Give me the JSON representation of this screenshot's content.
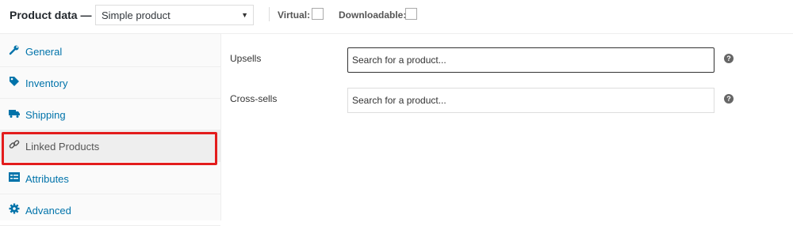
{
  "header": {
    "title": "Product data —",
    "product_type": "Simple product",
    "virtual_label": "Virtual:",
    "downloadable_label": "Downloadable:",
    "virtual_checked": false,
    "downloadable_checked": false
  },
  "sidebar": {
    "items": [
      {
        "label": "General",
        "icon": "wrench-icon"
      },
      {
        "label": "Inventory",
        "icon": "tag-icon"
      },
      {
        "label": "Shipping",
        "icon": "truck-icon"
      },
      {
        "label": "Linked Products",
        "icon": "link-icon"
      },
      {
        "label": "Attributes",
        "icon": "list-icon"
      },
      {
        "label": "Advanced",
        "icon": "gear-icon"
      }
    ],
    "active_index": 3
  },
  "main": {
    "upsells_label": "Upsells",
    "upsells_placeholder": "Search for a product...",
    "crosssells_label": "Cross-sells",
    "crosssells_placeholder": "Search for a product...",
    "help_glyph": "?"
  },
  "colors": {
    "link": "#0073aa",
    "highlight": "#e31c1c",
    "active_tab_bg": "#eeeeee"
  }
}
